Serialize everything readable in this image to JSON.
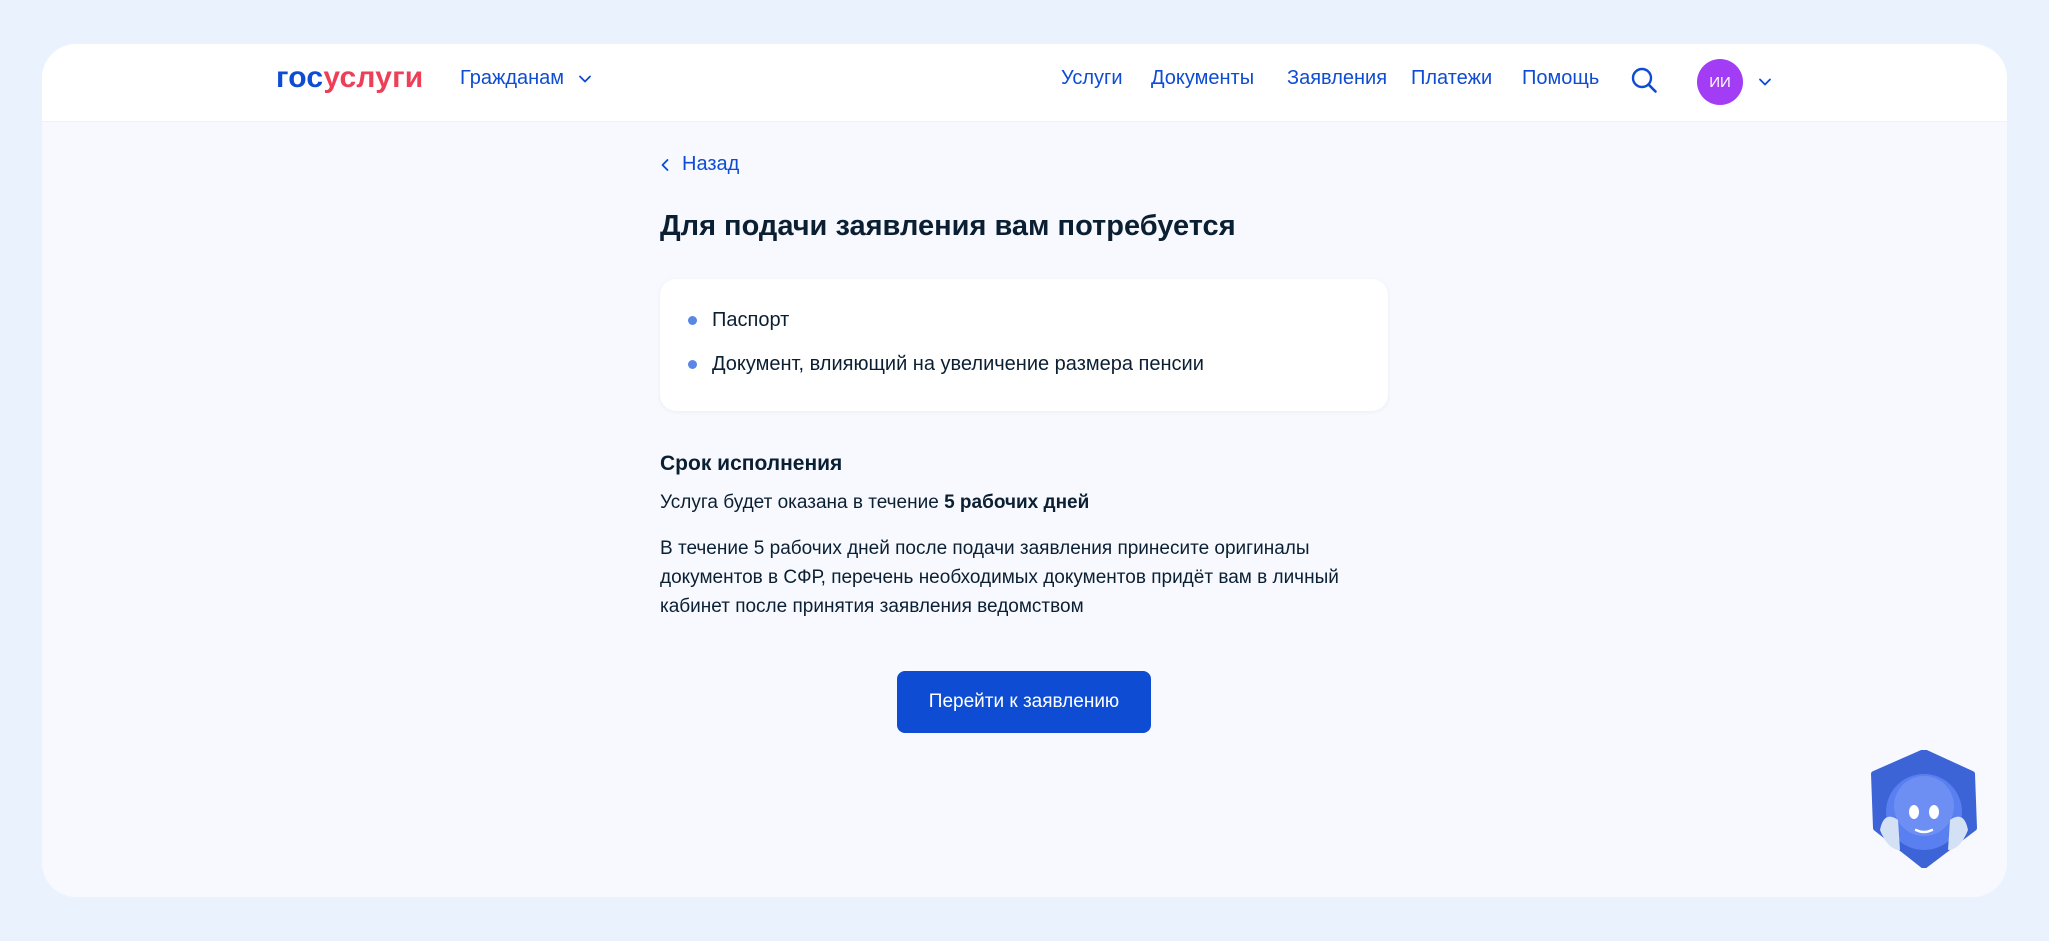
{
  "header": {
    "logo": {
      "part1": "гос",
      "part2": "услуги"
    },
    "audience_label": "Гражданам",
    "nav": [
      "Услуги",
      "Документы",
      "Заявления",
      "Платежи",
      "Помощь"
    ],
    "avatar_initials": "ИИ",
    "icons": {
      "audience": "chevron-down-icon",
      "search": "search-icon",
      "profile": "chevron-down-icon"
    }
  },
  "main": {
    "back_label": "Назад",
    "title": "Для подачи заявления вам потребуется",
    "requirements": [
      "Паспорт",
      "Документ, влияющий на увеличение размера пенсии"
    ],
    "term": {
      "heading": "Срок исполнения",
      "text_prefix": "Услуга будет оказана в течение",
      "text_bold": "5 рабочих дней"
    },
    "description": "В течение 5 рабочих дней после подачи заявления принесите оригиналы документов в СФР, перечень необходимых документов придёт вам в личный кабинет после принятия заявления ведомством",
    "cta_label": "Перейти к заявлению"
  },
  "assistant": {
    "icon": "robot-assistant-icon"
  },
  "colors": {
    "page_bg": "#eaf3fd",
    "content_bg": "#f7f9fe",
    "brand_blue": "#0d4cd3",
    "brand_red": "#ee3f58",
    "text_dark": "#0b1f33",
    "avatar_purple": "#a23cf5"
  }
}
